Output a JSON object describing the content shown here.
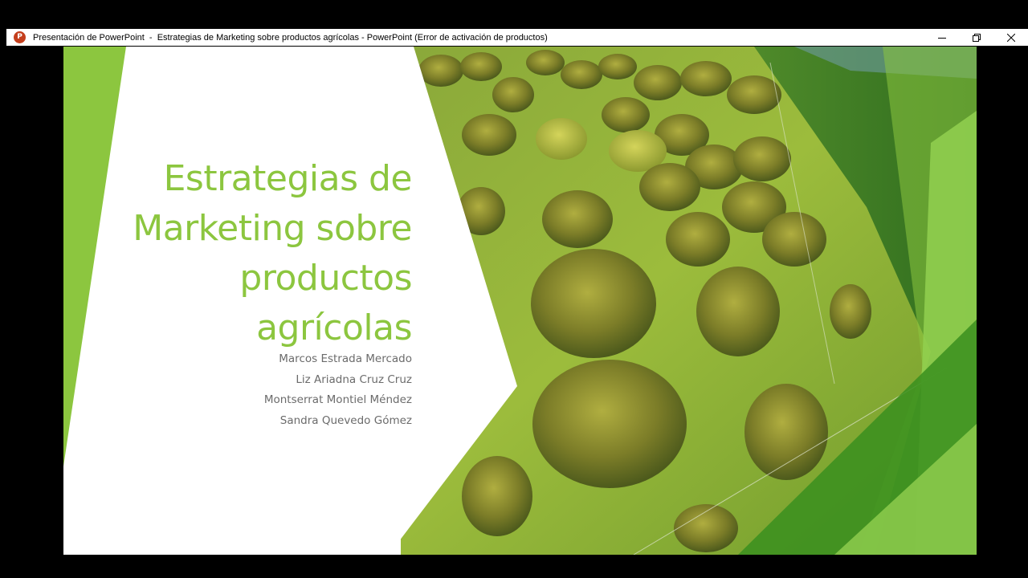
{
  "window": {
    "app_icon_letter": "P",
    "title": "Presentación de PowerPoint  -  Estrategias de Marketing sobre productos agrícolas - PowerPoint (Error de activación de productos)",
    "controls": [
      "minimize-icon",
      "restore-icon",
      "close-icon"
    ]
  },
  "slide": {
    "title_lines": [
      "Estrategias de",
      "Marketing sobre",
      "productos",
      "agrícolas"
    ],
    "authors": [
      "Marcos Estrada Mercado",
      "Liz Ariadna Cruz Cruz",
      "Montserrat Montiel Méndez",
      "Sandra Quevedo Gómez"
    ],
    "background_image": "aerial-orchard-photo",
    "colors": {
      "accent_green": "#8cc63f",
      "bright_green": "#92d050",
      "dark_green": "#3a8f1f",
      "author_gray": "#6b6b6b"
    }
  }
}
